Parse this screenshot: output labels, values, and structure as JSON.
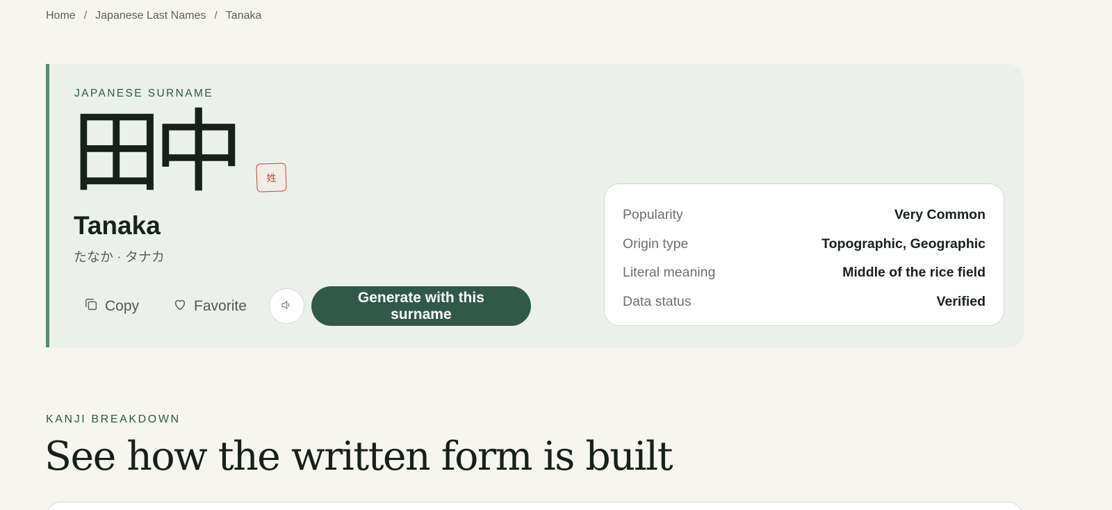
{
  "breadcrumb": {
    "items": [
      "Home",
      "Japanese Last Names",
      "Tanaka"
    ],
    "separator": "/"
  },
  "hero": {
    "eyebrow": "JAPANESE SURNAME",
    "kanji": [
      "田",
      "中"
    ],
    "seal_char": "姓",
    "romaji": "Tanaka",
    "kana": "たなか · タナカ",
    "actions": {
      "copy_label": "Copy",
      "favorite_label": "Favorite",
      "generate_label": "Generate with this surname"
    },
    "icons": {
      "copy": "copy-icon",
      "favorite": "heart-icon",
      "sound": "speaker-icon"
    }
  },
  "info": {
    "rows": [
      {
        "label": "Popularity",
        "value": "Very Common"
      },
      {
        "label": "Origin type",
        "value": "Topographic, Geographic"
      },
      {
        "label": "Literal meaning",
        "value": "Middle of the rice field"
      },
      {
        "label": "Data status",
        "value": "Verified"
      }
    ]
  },
  "section": {
    "eyebrow": "KANJI BREAKDOWN",
    "title": "See how the written form is built"
  },
  "colors": {
    "background": "#f6f5f0",
    "hero_bg": "#ecf0eb",
    "accent": "#30594a",
    "accent_bar": "#5f8a70",
    "seal": "#b5493c",
    "eyebrow": "#2e5a44"
  }
}
